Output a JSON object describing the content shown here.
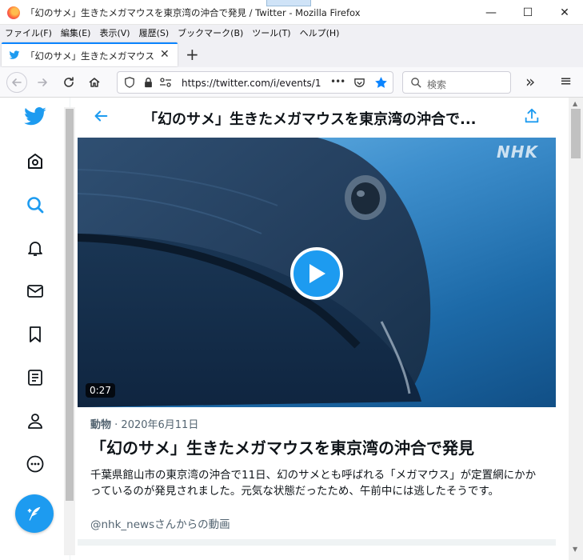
{
  "window": {
    "title": "「幻のサメ」生きたメガマウスを東京湾の沖合で発見 / Twitter - Mozilla Firefox",
    "minimize": "—",
    "maximize": "☐",
    "close": "✕"
  },
  "menu": [
    "ファイル(F)",
    "編集(E)",
    "表示(V)",
    "履歴(S)",
    "ブックマーク(B)",
    "ツール(T)",
    "ヘルプ(H)"
  ],
  "tab": {
    "title": "「幻のサメ」生きたメガマウスを東京",
    "close": "✕",
    "new_tab": "+"
  },
  "nav": {
    "url": "https://twitter.com/i/events/1",
    "more": "•••",
    "search_placeholder": "検索",
    "overflow": "»",
    "menu": "≡"
  },
  "article": {
    "header_title": "「幻のサメ」生きたメガマウスを東京湾の沖合で...",
    "video_logo": "NHK",
    "duration": "0:27",
    "category": "動物",
    "separator": " · ",
    "date": "2020年6月11日",
    "headline": "「幻のサメ」生きたメガマウスを東京湾の沖合で発見",
    "description": "千葉県館山市の東京湾の沖合で11日、幻のサメとも呼ばれる「メガマウス」が定置網にかかっているのが発見されました。元気な状態だったため、午前中には逃したそうです。",
    "source": "@nhk_newsさんからの動画"
  },
  "colors": {
    "twitter_blue": "#1d9bf0",
    "firefox_accent": "#0a84ff"
  },
  "icons": [
    "twitter-logo-icon",
    "explore-icon",
    "search-icon",
    "bell-icon",
    "mail-icon",
    "bookmark-icon",
    "list-icon",
    "profile-icon",
    "more-icon",
    "compose-icon",
    "play-icon",
    "share-icon",
    "back-arrow-icon"
  ]
}
